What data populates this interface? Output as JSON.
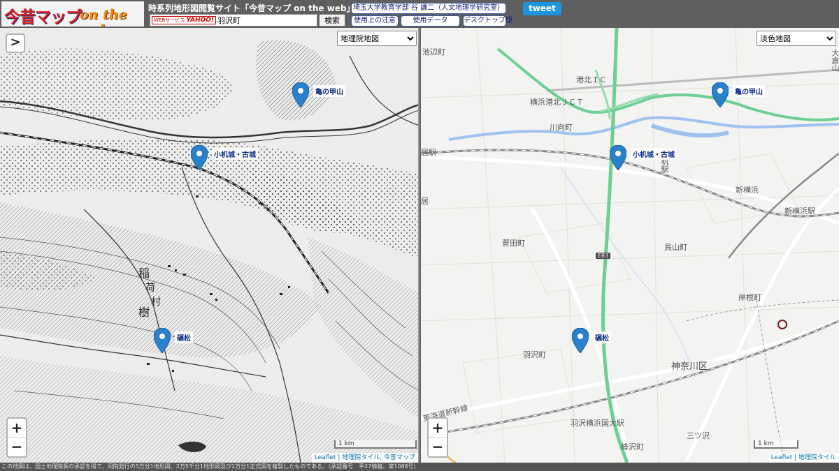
{
  "header": {
    "logo_main": "今昔マップ",
    "logo_sub": "on the web",
    "site_title": "時系列地形図閲覧サイト「今昔マップ on the web」",
    "yahoo_tag_prefix": "WEBサービス",
    "yahoo_tag_brand": "YAHOO!",
    "search_value": "羽沢町",
    "search_button": "検索",
    "author_link": "埼玉大学教育学部 谷 謙二（人文地理学研究室）",
    "notice_button": "使用上の注意",
    "data_button": "使用データ",
    "desktop_button": "デスクトップ版",
    "tweet_button": "tweet"
  },
  "left_map": {
    "layer_select": "地理院地図",
    "sidebar_toggle": ">",
    "zoom_in": "+",
    "zoom_out": "−",
    "scale": "1 km",
    "attribution": [
      "Leaflet",
      "地理院タイル",
      "今昔マップ"
    ],
    "markers": [
      "亀の甲山",
      "小机城・古城",
      "碾松"
    ],
    "places": [
      "稲",
      "荷",
      "村",
      "樹"
    ]
  },
  "right_map": {
    "layer_select": "淡色地図",
    "zoom_in": "+",
    "zoom_out": "−",
    "scale": "1 km",
    "attribution": [
      "Leaflet",
      "地理院タイル"
    ],
    "markers": [
      "亀の甲山",
      "小机城・古城",
      "碾松"
    ],
    "places": {
      "ikenobe": "池辺町",
      "kohoku": "港北ＩＣ",
      "kohoku_jct": "横浜港北ＪＣＴ",
      "kawamukai": "川向町",
      "kozukue_station": "机駅",
      "shinyokohama": "新横浜",
      "shinyokohama_station": "新横浜駅",
      "sugeta": "菅田町",
      "toriyama": "鳥山町",
      "kishine": "岸根町",
      "hazawa": "羽沢町",
      "kanagawa_ku": "神奈川区",
      "hazawa_station": "羽沢横浜国大駅",
      "minezawa": "峰沢町",
      "mitsuzawa": "三ツ沢",
      "tokaido": "東海道新幹線",
      "i_station": "居駅",
      "i": "居",
      "okurayama": "大倉山",
      "road_badge": "E83"
    }
  },
  "footer": {
    "text": "この地図は、国土地理院長の承認を得て、同院発行の5万分1地形図、2万5千分1地形図及び2万分1正式図を複製したものである。（承認番号　平27情複、第1088号）"
  },
  "colors": {
    "marker_blue": "#2a81cb",
    "expressway_green": "#6dcf93",
    "river_blue": "#9ec2ef"
  }
}
